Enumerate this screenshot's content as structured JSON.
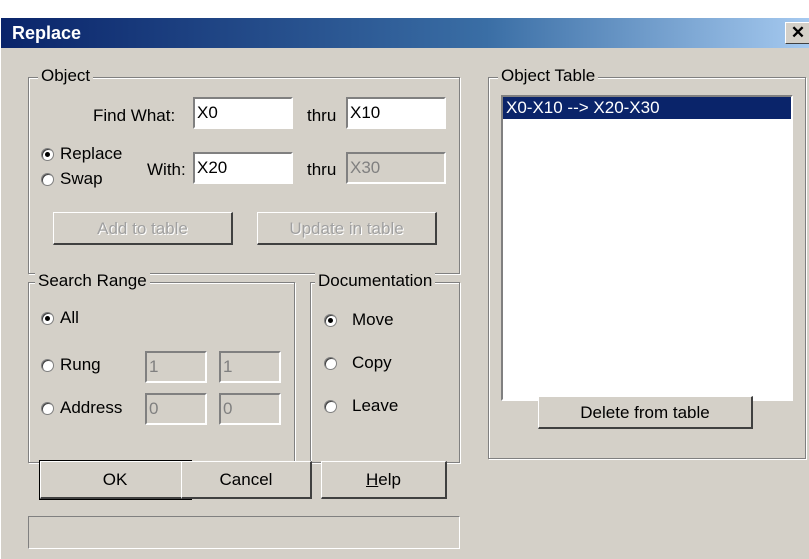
{
  "window": {
    "title": "Replace",
    "close_glyph": "✕"
  },
  "object_group": {
    "label": "Object",
    "find_what_label": "Find What:",
    "find_what_value": "X0",
    "find_thru_label": "thru",
    "find_thru_value": "X10",
    "replace_label": "Replace",
    "swap_label": "Swap",
    "with_label": "With:",
    "with_value": "X20",
    "with_thru_label": "thru",
    "with_thru_value": "X30",
    "selected_mode": "Replace",
    "add_to_table_label": "Add to table",
    "update_in_table_label": "Update in table"
  },
  "search_range": {
    "label": "Search Range",
    "all_label": "All",
    "rung_label": "Rung",
    "rung_from": "1",
    "rung_to": "1",
    "address_label": "Address",
    "address_from": "0",
    "address_to": "0",
    "selected": "All"
  },
  "documentation": {
    "label": "Documentation",
    "move_label": "Move",
    "copy_label": "Copy",
    "leave_label": "Leave",
    "selected": "Move"
  },
  "object_table": {
    "label": "Object Table",
    "items": [
      "X0-X10 --> X20-X30"
    ],
    "delete_label": "Delete from table"
  },
  "buttons": {
    "ok_label": "OK",
    "cancel_label": "Cancel",
    "help_label_underlined": "H",
    "help_label_rest": "elp"
  },
  "status_text": "",
  "colors": {
    "dialog_bg": "#d4d0c8",
    "title_bar_start": "#0a246a",
    "title_bar_end": "#a6caf0",
    "selection": "#0a246a"
  }
}
